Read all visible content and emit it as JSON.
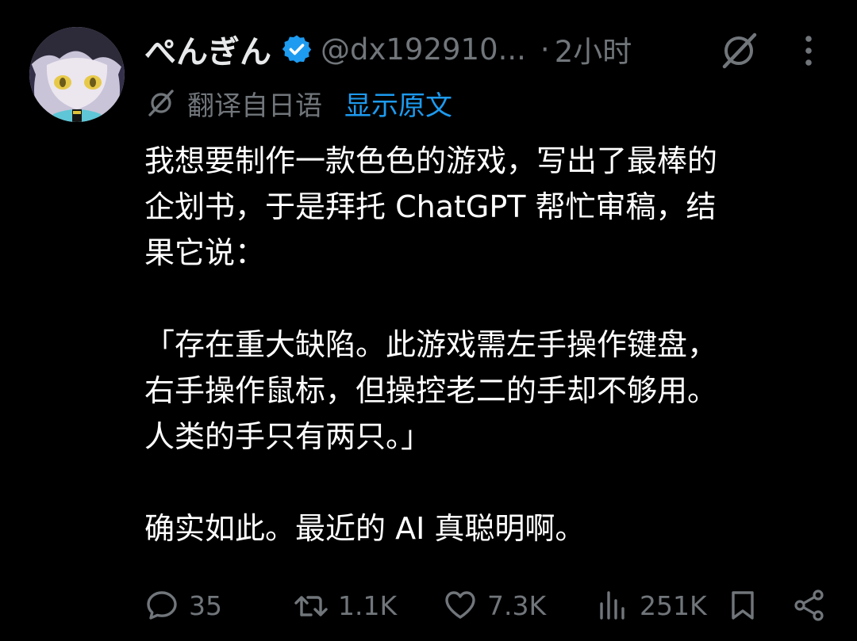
{
  "post": {
    "author": {
      "display_name": "ぺんぎん",
      "handle": "@dx192910...",
      "verified": true,
      "avatar": "anime-character-avatar"
    },
    "separator": "·",
    "time": "2小时",
    "translation": {
      "label": "翻译自日语",
      "show_original": "显示原文"
    },
    "body": {
      "line1": "我想要制作一款色色的游戏，写出了最棒的",
      "line2": "企划书，于是拜托 ChatGPT 帮忙审稿，结",
      "line3": "果它说：",
      "line4": "「存在重大缺陷。此游戏需左手操作键盘，",
      "line5": "右手操作鼠标，但操控老二的手却不够用。",
      "line6": "人类的手只有两只。」",
      "line7": "确实如此。最近的 AI 真聪明啊。"
    },
    "metrics": {
      "replies": "35",
      "reposts": "1.1K",
      "likes": "7.3K",
      "views": "251K"
    }
  },
  "icons": {
    "verified": "verified-badge-icon",
    "grok": "grok-icon",
    "more": "more-vertical-icon",
    "translate": "translate-icon",
    "reply": "reply-icon",
    "repost": "repost-icon",
    "like": "like-icon",
    "views": "views-icon",
    "bookmark": "bookmark-icon",
    "share": "share-icon"
  },
  "colors": {
    "background": "#000000",
    "text": "#ffffff",
    "muted": "#71767b",
    "link": "#1d9bf0",
    "verified": "#1d9bf0"
  }
}
